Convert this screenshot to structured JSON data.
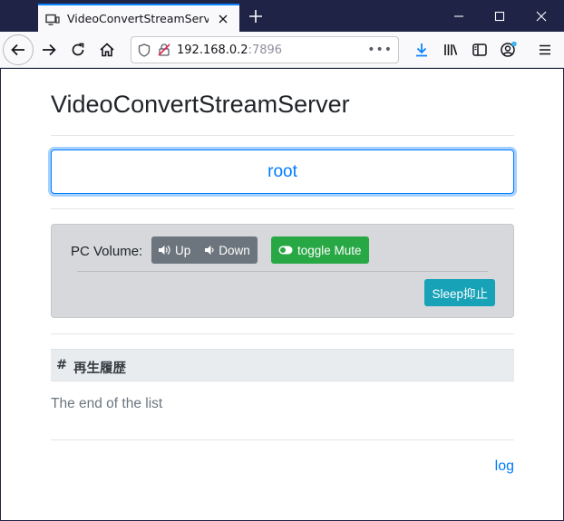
{
  "browser": {
    "tab_title": "VideoConvertStreamServer",
    "url_host": "192.168.0.2",
    "url_port": ":7896",
    "url_more": "•••"
  },
  "page": {
    "title": "VideoConvertStreamServer",
    "root_button": "root",
    "volume": {
      "label": "PC Volume:",
      "up": "Up",
      "down": "Down",
      "mute": "toggle Mute"
    },
    "sleep_button": "Sleep抑止",
    "table": {
      "col_index": "#",
      "col_history": "再生履歴"
    },
    "end_text": "The end of the list",
    "log_link": "log"
  },
  "colors": {
    "primary": "#007bff",
    "secondary": "#6c757d",
    "success": "#28a745",
    "info": "#17a2b8",
    "chrome_dark": "#1f2345"
  }
}
